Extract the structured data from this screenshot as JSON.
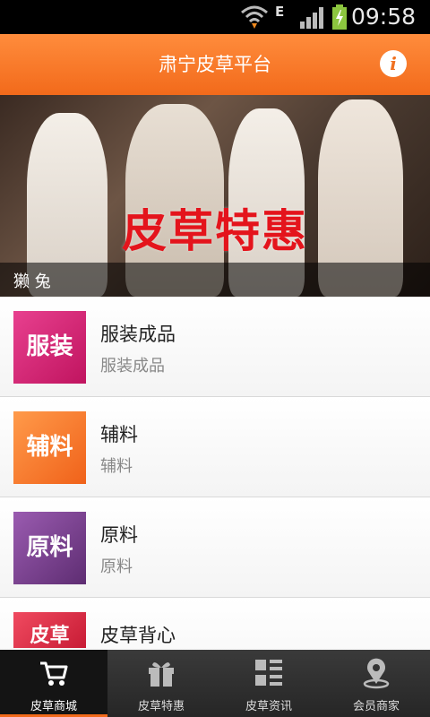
{
  "status_bar": {
    "time": "09:58",
    "network": "E"
  },
  "header": {
    "title": "肃宁皮草平台",
    "info_icon": "info-icon"
  },
  "banner": {
    "promo_text": "皮草特惠",
    "caption": "獭 兔"
  },
  "categories": [
    {
      "title": "服装成品",
      "subtitle": "服装成品",
      "thumb_text": "服装",
      "thumb_color": "#d41c73"
    },
    {
      "title": "辅料",
      "subtitle": "辅料",
      "thumb_text": "辅料",
      "thumb_color": "#ff7a2e"
    },
    {
      "title": "原料",
      "subtitle": "原料",
      "thumb_text": "原料",
      "thumb_color": "#7a3f8e"
    },
    {
      "title": "皮草背心",
      "subtitle": "",
      "thumb_text": "皮草",
      "thumb_color": "#e8334a"
    }
  ],
  "bottom_nav": {
    "tabs": [
      {
        "label": "皮草商城",
        "icon": "cart-icon",
        "active": true
      },
      {
        "label": "皮草特惠",
        "icon": "gift-icon",
        "active": false
      },
      {
        "label": "皮草资讯",
        "icon": "grid-list-icon",
        "active": false
      },
      {
        "label": "会员商家",
        "icon": "location-pin-icon",
        "active": false
      }
    ]
  },
  "colors": {
    "accent": "#f26a1b",
    "promo_red": "#e4141c"
  }
}
